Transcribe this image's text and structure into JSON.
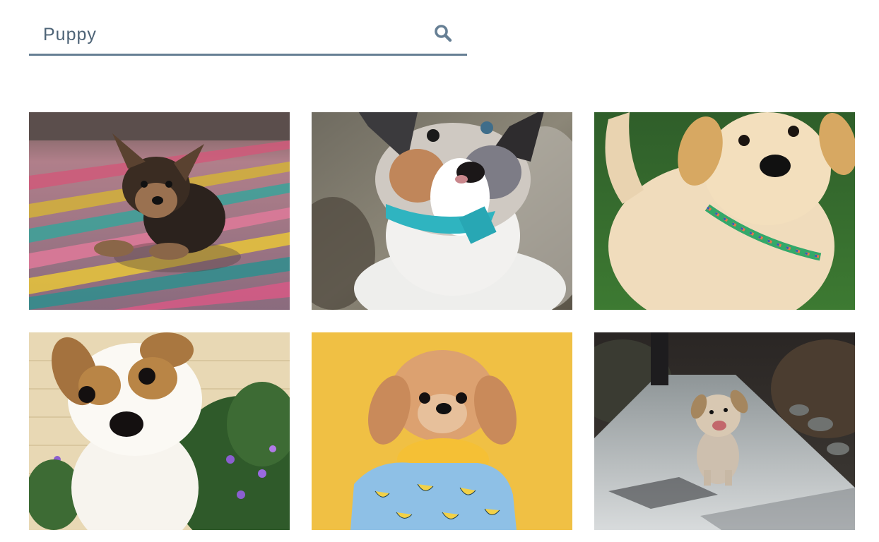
{
  "search": {
    "value": "Puppy",
    "icon": "search-icon"
  },
  "colors": {
    "accent": "#667f94",
    "text": "#4e6477"
  },
  "results": [
    {
      "icon": "puppy-yorkie-photo"
    },
    {
      "icon": "puppy-aussie-photo"
    },
    {
      "icon": "puppy-golden-grass-photo"
    },
    {
      "icon": "puppy-jack-russell-photo"
    },
    {
      "icon": "puppy-shihtzu-yellow-photo"
    },
    {
      "icon": "puppy-running-path-photo"
    }
  ]
}
